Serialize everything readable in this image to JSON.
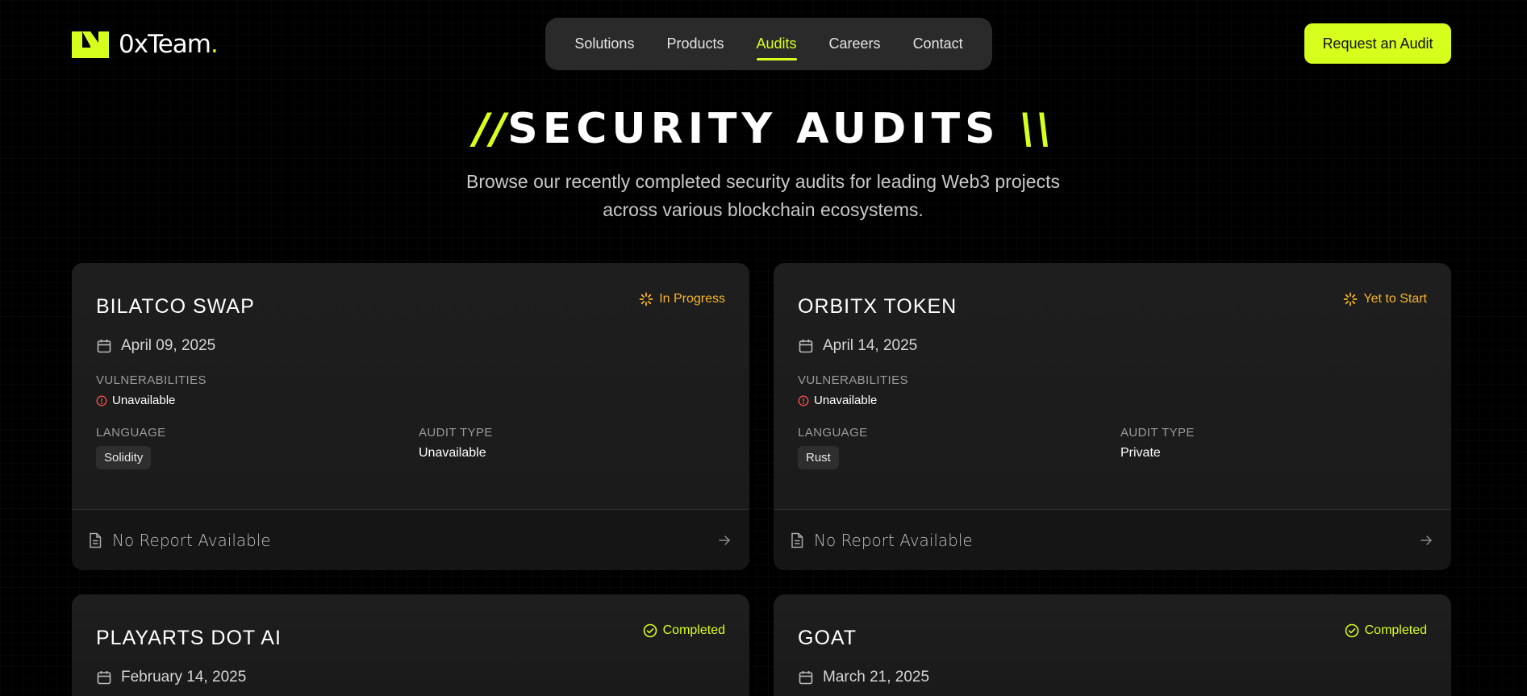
{
  "nav": {
    "logo_text": "0xTeam",
    "logo_dot": ".",
    "items": [
      {
        "label": "Solutions"
      },
      {
        "label": "Products"
      },
      {
        "label": "Audits"
      },
      {
        "label": "Careers"
      },
      {
        "label": "Contact"
      }
    ],
    "active_item": "Audits",
    "cta_label": "Request an Audit"
  },
  "hero": {
    "slash_left": "//",
    "title": "SECURITY AUDITS",
    "slash_right": "\\\\",
    "subtitle_line1": "Browse our recently completed security audits for leading Web3 projects",
    "subtitle_line2": "across various blockchain ecosystems."
  },
  "labels": {
    "vulnerabilities": "VULNERABILITIES",
    "language": "LANGUAGE",
    "audit_type": "AUDIT TYPE",
    "no_report": "No Report Available"
  },
  "cards": [
    {
      "name": "BILATCO SWAP",
      "status": "In Progress",
      "status_icon": "spinner-icon",
      "date": "April 09, 2025",
      "vulnerabilities": "Unavailable",
      "language": "Solidity",
      "audit_type": "Unavailable"
    },
    {
      "name": "ORBITX TOKEN",
      "status": "Yet to Start",
      "status_icon": "spinner-icon",
      "date": "April 14, 2025",
      "vulnerabilities": "Unavailable",
      "language": "Rust",
      "audit_type": "Private"
    },
    {
      "name": "PLAYARTS DOT AI",
      "status": "Completed",
      "status_icon": "check-circle-icon",
      "date": "February 14, 2025"
    },
    {
      "name": "GOAT",
      "status": "Completed",
      "status_icon": "check-circle-icon",
      "date": "March 21, 2025"
    }
  ],
  "colors": {
    "accent": "#d7ff1e",
    "status_pending": "#f5b52a",
    "status_completed": "#d7ff1e",
    "error": "#ff4d4d",
    "card_bg": "#1c1c1c",
    "page_bg": "#000000"
  }
}
